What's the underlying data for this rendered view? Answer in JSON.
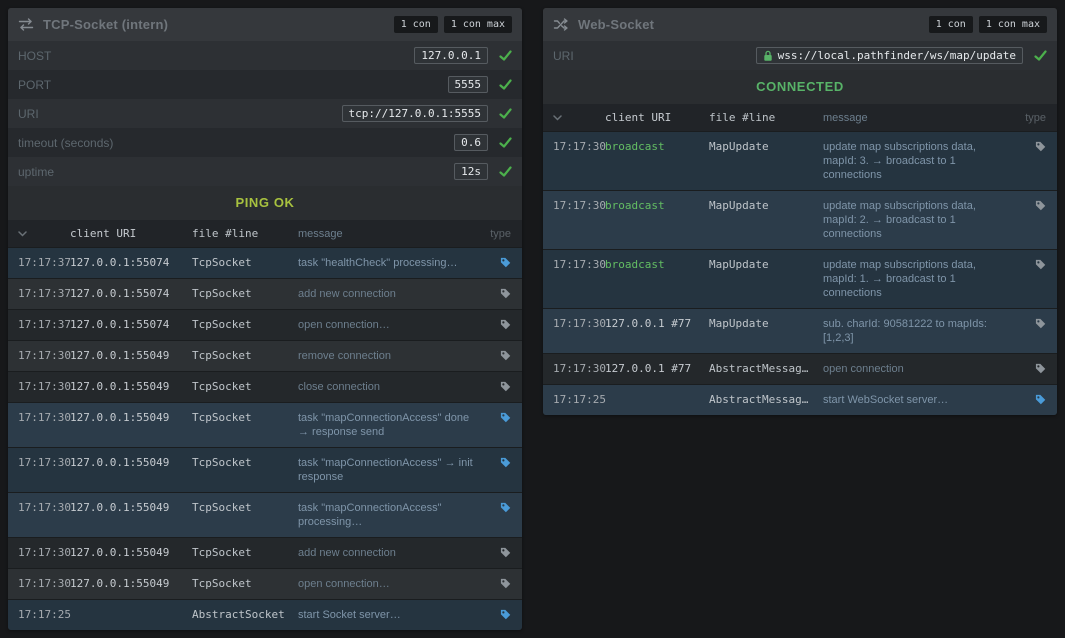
{
  "colors": {
    "ping_ok": "#a8c23f",
    "connected": "#58b368",
    "tag_info": "#4a9bd8",
    "tag_debug": "#8e959b",
    "check_ok": "#4cb04c",
    "broadcast": "#63bd63",
    "lock": "#58b368"
  },
  "tcp_panel": {
    "title": "TCP-Socket (intern)",
    "badge_connections": "1 con",
    "badge_connections_max": "1 con max",
    "fields": [
      {
        "label": "HOST",
        "value": "127.0.0.1"
      },
      {
        "label": "PORT",
        "value": "5555"
      },
      {
        "label": "URI",
        "value": "tcp://127.0.0.1:5555"
      },
      {
        "label": "timeout (seconds)",
        "value": "0.6"
      },
      {
        "label": "uptime",
        "value": "12s"
      }
    ],
    "status": "PING OK",
    "table": {
      "headers": {
        "client": "client URI",
        "file": "file #line",
        "message": "message",
        "type": "type"
      },
      "rows": [
        {
          "time": "17:17:37",
          "client": "127.0.0.1:55074",
          "file": "TcpSocket",
          "message": "task \"healthCheck\" processing…",
          "level": "info"
        },
        {
          "time": "17:17:37",
          "client": "127.0.0.1:55074",
          "file": "TcpSocket",
          "message": "add new connection",
          "level": "debug"
        },
        {
          "time": "17:17:37",
          "client": "127.0.0.1:55074",
          "file": "TcpSocket",
          "message": "open connection…",
          "level": "debug"
        },
        {
          "time": "17:17:30",
          "client": "127.0.0.1:55049",
          "file": "TcpSocket",
          "message": "remove connection",
          "level": "debug"
        },
        {
          "time": "17:17:30",
          "client": "127.0.0.1:55049",
          "file": "TcpSocket",
          "message": "close connection",
          "level": "debug"
        },
        {
          "time": "17:17:30",
          "client": "127.0.0.1:55049",
          "file": "TcpSocket",
          "message": "task \"mapConnectionAccess\" done → response send",
          "level": "info"
        },
        {
          "time": "17:17:30",
          "client": "127.0.0.1:55049",
          "file": "TcpSocket",
          "message": "task \"mapConnectionAccess\" → init response",
          "level": "info"
        },
        {
          "time": "17:17:30",
          "client": "127.0.0.1:55049",
          "file": "TcpSocket",
          "message": "task \"mapConnectionAccess\" processing…",
          "level": "info"
        },
        {
          "time": "17:17:30",
          "client": "127.0.0.1:55049",
          "file": "TcpSocket",
          "message": "add new connection",
          "level": "debug"
        },
        {
          "time": "17:17:30",
          "client": "127.0.0.1:55049",
          "file": "TcpSocket",
          "message": "open connection…",
          "level": "debug"
        },
        {
          "time": "17:17:25",
          "client": "",
          "file": "AbstractSocket",
          "message": "start Socket server…",
          "level": "info"
        }
      ]
    }
  },
  "ws_panel": {
    "title": "Web-Socket",
    "badge_connections": "1 con",
    "badge_connections_max": "1 con max",
    "fields": [
      {
        "label": "URI",
        "value": "wss://local.pathfinder/ws/map/update",
        "lock": true
      }
    ],
    "status": "CONNECTED",
    "table": {
      "headers": {
        "client": "client URI",
        "file": "file #line",
        "message": "message",
        "type": "type"
      },
      "rows": [
        {
          "time": "17:17:30",
          "client": "broadcast",
          "client_green": true,
          "file": "MapUpdate",
          "message": "update map subscriptions data, mapId: 3. → broadcast to 1 connections",
          "level": "debug",
          "fresh": true
        },
        {
          "time": "17:17:30",
          "client": "broadcast",
          "client_green": true,
          "file": "MapUpdate",
          "message": "update map subscriptions data, mapId: 2. → broadcast to 1 connections",
          "level": "debug",
          "fresh": true
        },
        {
          "time": "17:17:30",
          "client": "broadcast",
          "client_green": true,
          "file": "MapUpdate",
          "message": "update map subscriptions data, mapId: 1. → broadcast to 1 connections",
          "level": "debug",
          "fresh": true
        },
        {
          "time": "17:17:30",
          "client": "127.0.0.1 #77",
          "file": "MapUpdate",
          "message": "sub. charId: 90581222 to mapIds: [1,2,3]",
          "level": "debug",
          "fresh": true
        },
        {
          "time": "17:17:30",
          "client": "127.0.0.1 #77",
          "file": "AbstractMessag…",
          "message": "open connection",
          "level": "debug"
        },
        {
          "time": "17:17:25",
          "client": "",
          "file": "AbstractMessag…",
          "message": "start WebSocket server…",
          "level": "info"
        }
      ]
    }
  }
}
